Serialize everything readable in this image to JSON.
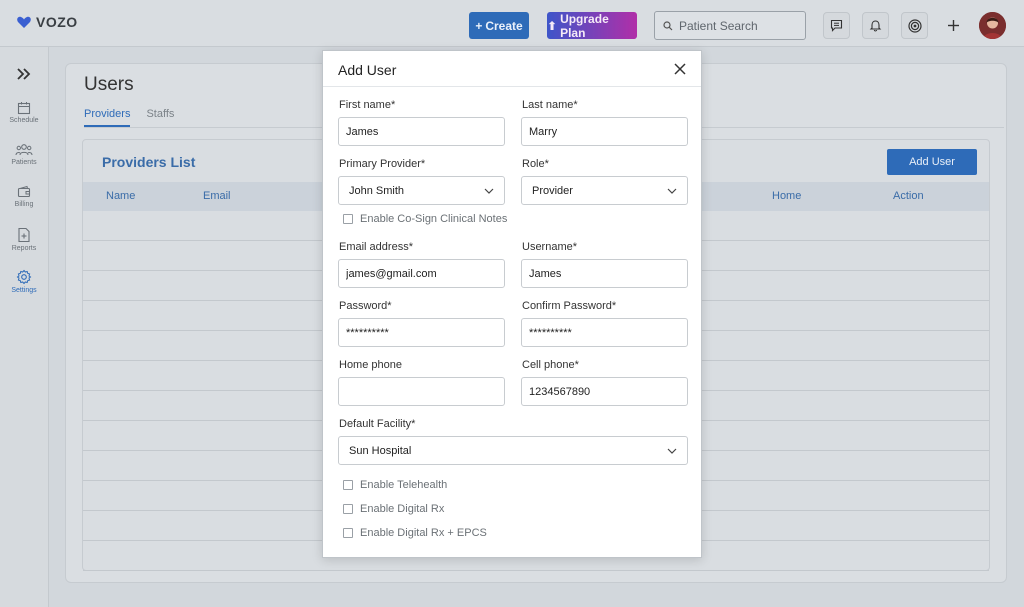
{
  "app": {
    "brand": "VOZO"
  },
  "topbar": {
    "create_label": "Create",
    "upgrade_label": "Upgrade Plan",
    "search_placeholder": "Patient Search"
  },
  "sidebar": {
    "items": [
      {
        "label": "Schedule",
        "icon": "calendar-icon"
      },
      {
        "label": "Patients",
        "icon": "patients-icon"
      },
      {
        "label": "Billing",
        "icon": "wallet-icon"
      },
      {
        "label": "Reports",
        "icon": "report-icon"
      },
      {
        "label": "Settings",
        "icon": "gear-icon"
      }
    ]
  },
  "page": {
    "title": "Users",
    "tabs": [
      "Providers",
      "Staffs"
    ],
    "list_title": "Providers List",
    "add_user_label": "Add User",
    "columns": {
      "name": "Name",
      "email": "Email",
      "home": "Home",
      "action": "Action"
    }
  },
  "modal": {
    "title": "Add User",
    "first_name_label": "First name*",
    "first_name": "James",
    "last_name_label": "Last name*",
    "last_name": "Marry",
    "primary_provider_label": "Primary Provider*",
    "primary_provider": "John Smith",
    "role_label": "Role*",
    "role": "Provider",
    "cosign_label": "Enable Co-Sign Clinical Notes",
    "email_label": "Email address*",
    "email": "james@gmail.com",
    "username_label": "Username*",
    "username": "James",
    "password_label": "Password*",
    "password": "**********",
    "confirm_password_label": "Confirm Password*",
    "confirm_password": "**********",
    "home_phone_label": "Home phone",
    "home_phone": "",
    "cell_phone_label": "Cell phone*",
    "cell_phone": "1234567890",
    "facility_label": "Default Facility*",
    "facility": "Sun Hospital",
    "telehealth_label": "Enable Telehealth",
    "digital_rx_label": "Enable Digital Rx",
    "digital_rx_epcs_label": "Enable Digital Rx + EPCS"
  },
  "colors": {
    "accent": "#2e6bb8",
    "upgrade_start": "#3e55c9",
    "upgrade_end": "#b12fa8"
  }
}
